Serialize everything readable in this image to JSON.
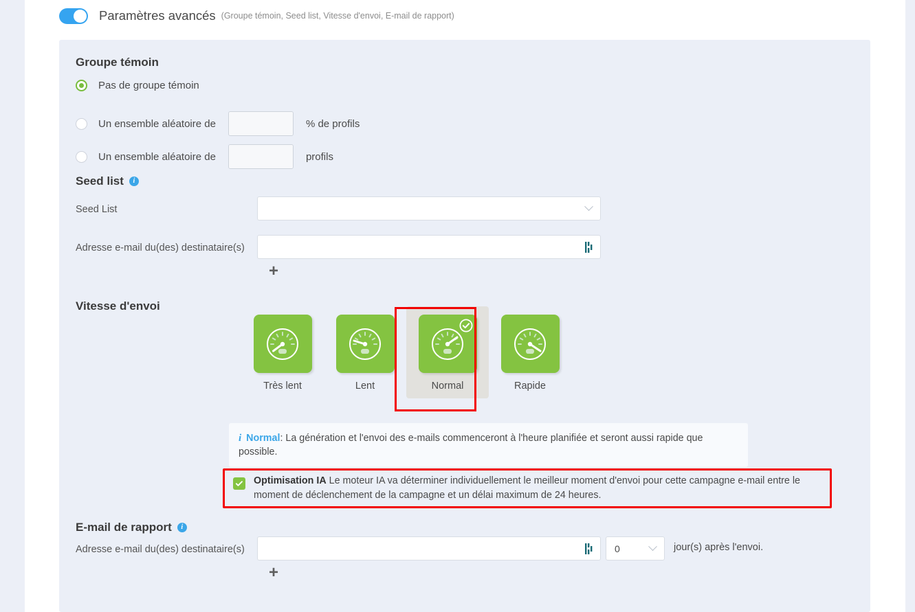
{
  "header": {
    "toggle_state": "on",
    "title": "Paramètres avancés",
    "subtitle": "(Groupe témoin, Seed list, Vitesse d'envoi, E-mail de rapport)"
  },
  "control_group": {
    "heading": "Groupe témoin",
    "options": [
      {
        "label": "Pas de groupe témoin",
        "selected": true,
        "unit": ""
      },
      {
        "label": "Un ensemble aléatoire de",
        "selected": false,
        "unit": "% de profils",
        "value": ""
      },
      {
        "label": "Un ensemble aléatoire de",
        "selected": false,
        "unit": "profils",
        "value": ""
      }
    ]
  },
  "seed_list": {
    "heading": "Seed list",
    "info_icon": "info-icon",
    "select_label": "Seed List",
    "select_value": "",
    "email_label": "Adresse e-mail du(des) destinataire(s)",
    "email_value": "",
    "add_label": "+"
  },
  "sending_speed": {
    "heading": "Vitesse d'envoi",
    "options": [
      {
        "label": "Très lent",
        "selected": false
      },
      {
        "label": "Lent",
        "selected": false
      },
      {
        "label": "Normal",
        "selected": true
      },
      {
        "label": "Rapide",
        "selected": false
      }
    ],
    "info": {
      "strong": "Normal",
      "text": ": La génération et l'envoi des e-mails commenceront à l'heure planifiée et seront aussi rapide que possible."
    }
  },
  "ai_optimisation": {
    "checked": true,
    "title": "Optimisation IA",
    "text": " Le moteur IA va déterminer individuellement le meilleur moment d'envoi pour cette campagne e-mail entre le moment de déclenchement de la campagne et un délai maximum de 24 heures."
  },
  "report_email": {
    "heading": "E-mail de rapport",
    "info_icon": "info-icon",
    "email_label": "Adresse e-mail du(des) destinataire(s)",
    "email_value": "",
    "days_value": "0",
    "days_suffix": "jour(s) après l'envoi.",
    "add_label": "+"
  },
  "colors": {
    "accent_blue": "#35a4f0",
    "green": "#84c341",
    "panel_bg": "#ebeff7",
    "highlight_red": "#f20000",
    "spinner_blue": "#8dc6e9"
  }
}
